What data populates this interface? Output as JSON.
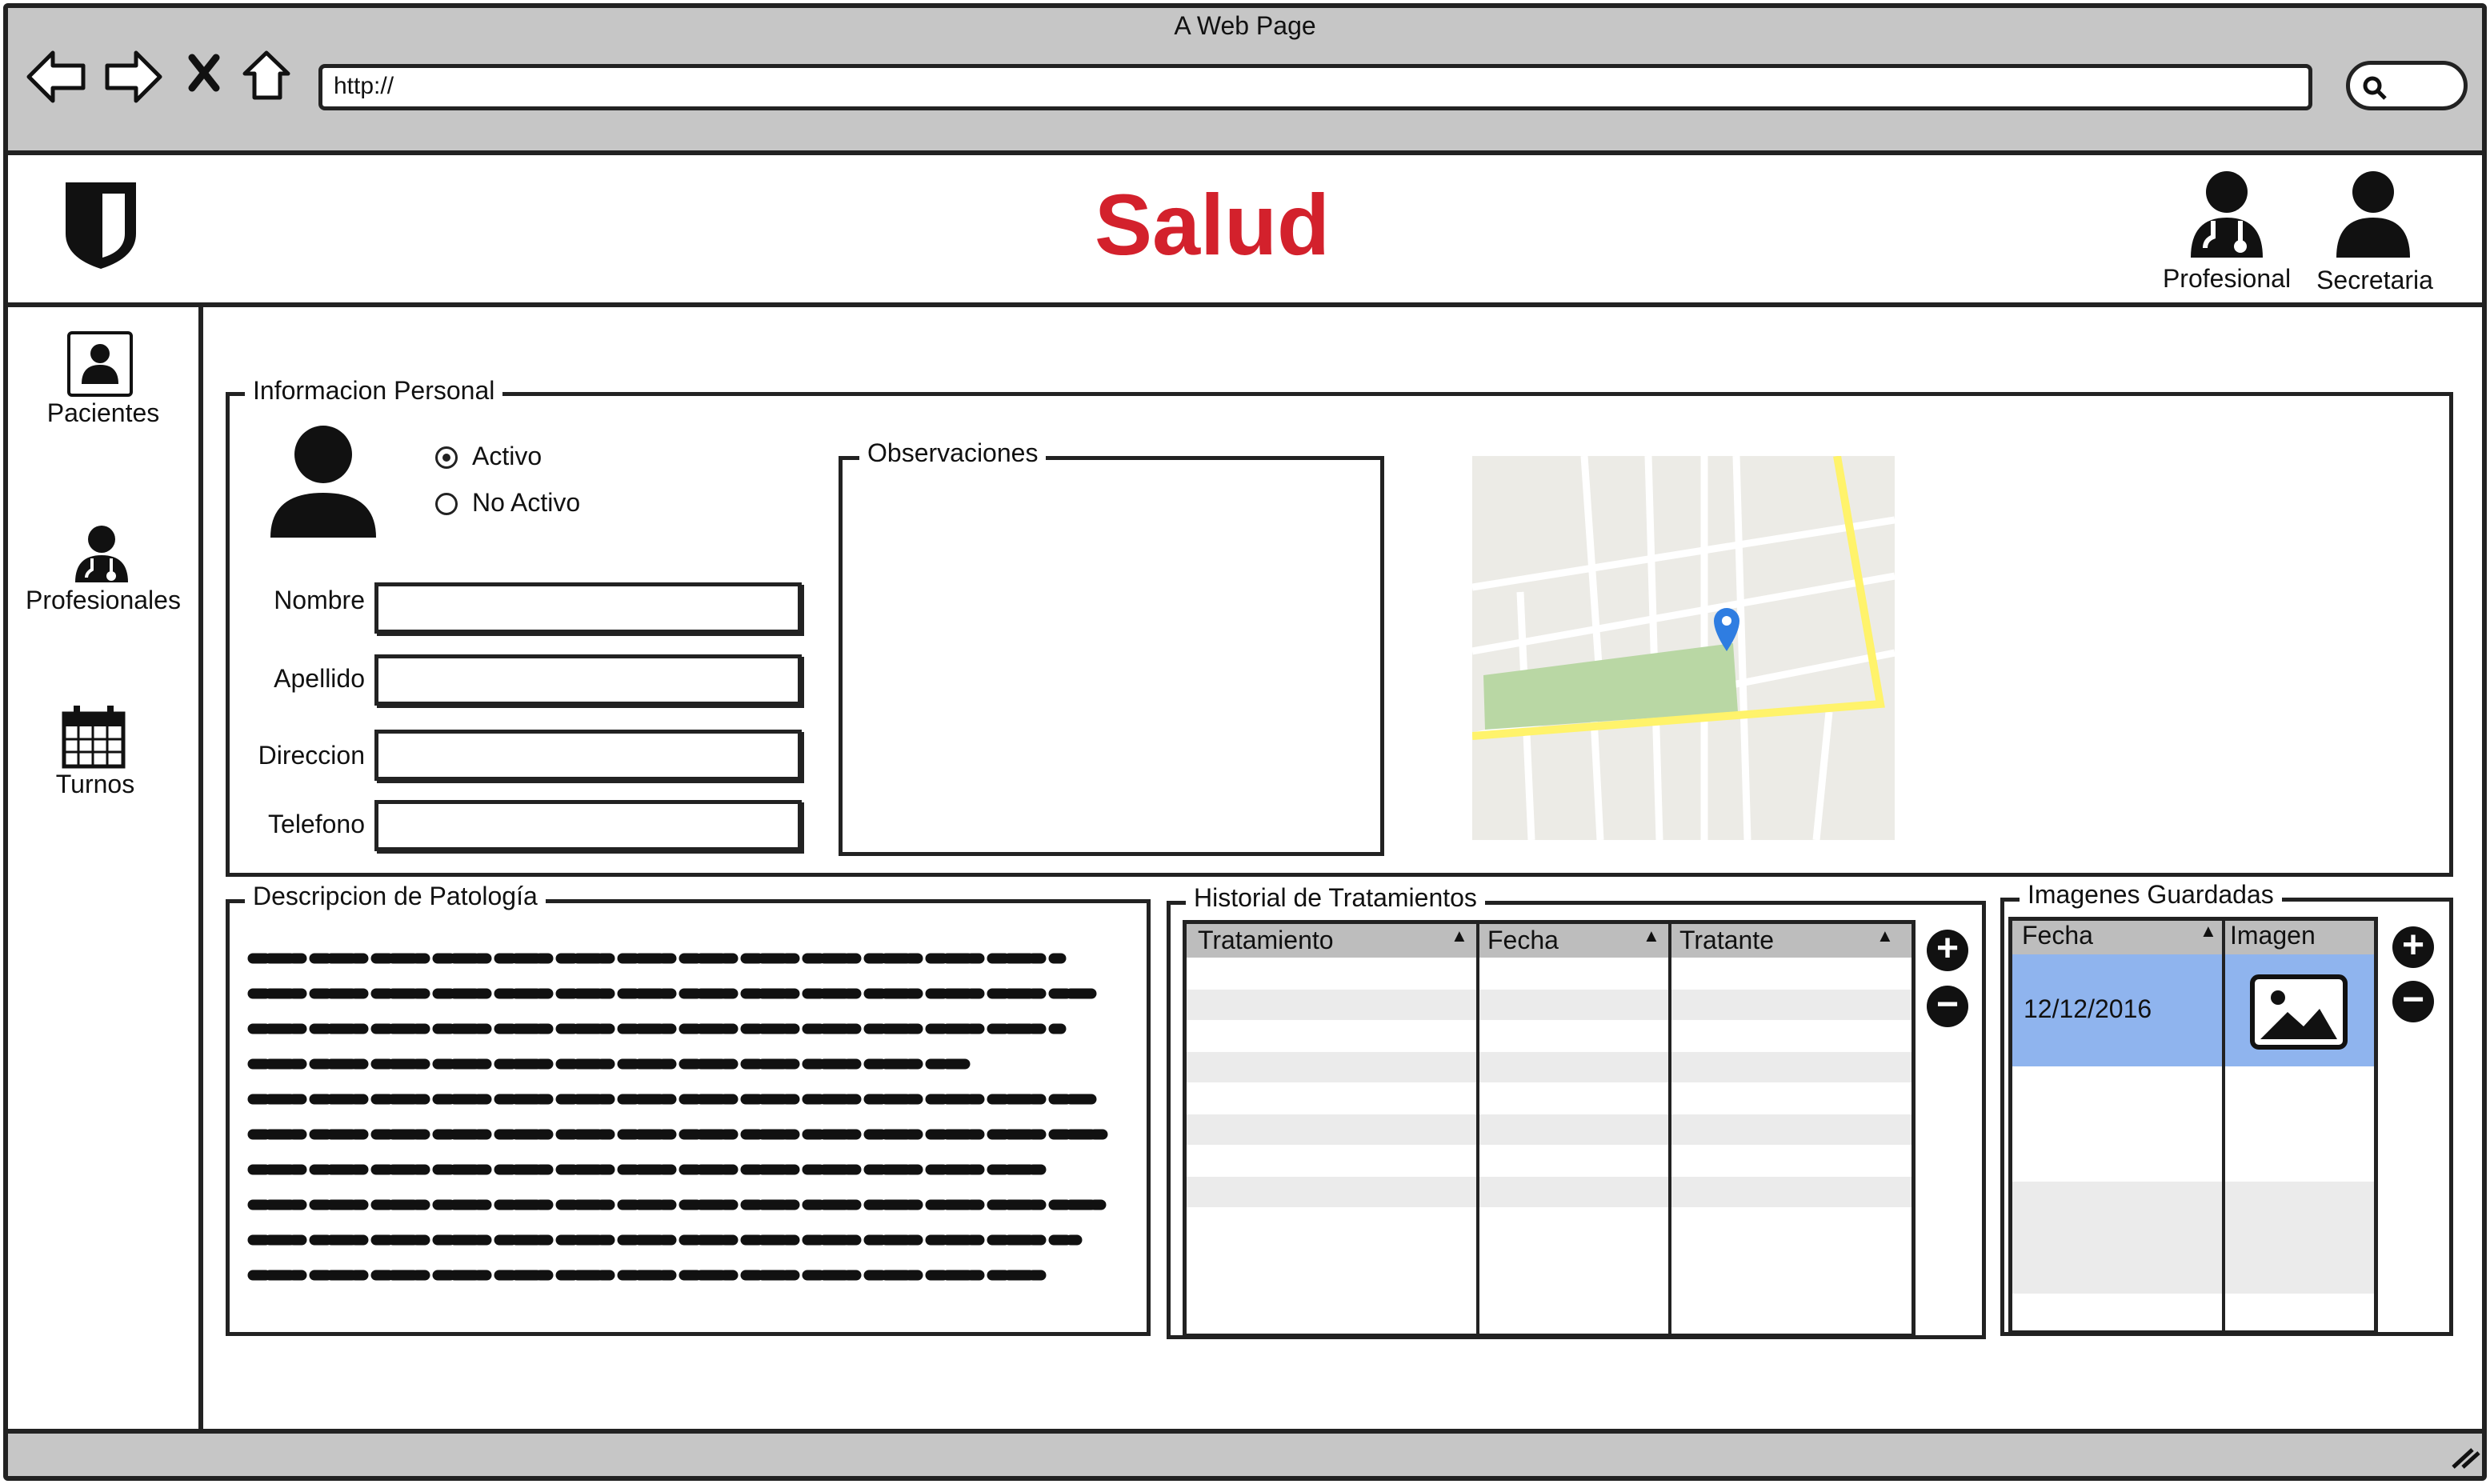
{
  "browser": {
    "window_title": "A Web Page",
    "url": "http://"
  },
  "header": {
    "app_title": "Salud",
    "users": [
      {
        "label": "Profesional",
        "icon": "doctor-icon"
      },
      {
        "label": "Secretaria",
        "icon": "user-icon"
      }
    ]
  },
  "sidebar": {
    "items": [
      {
        "label": "Pacientes",
        "icon": "patient-card-icon"
      },
      {
        "label": "Profesionales",
        "icon": "doctor-icon"
      },
      {
        "label": "Turnos",
        "icon": "calendar-icon"
      }
    ]
  },
  "personal_info": {
    "legend": "Informacion Personal",
    "status_options": [
      {
        "label": "Activo",
        "selected": true
      },
      {
        "label": "No Activo",
        "selected": false
      }
    ],
    "fields": [
      {
        "label": "Nombre",
        "value": ""
      },
      {
        "label": "Apellido",
        "value": ""
      },
      {
        "label": "Direccion",
        "value": ""
      },
      {
        "label": "Telefono",
        "value": ""
      }
    ],
    "observations_legend": "Observaciones",
    "observations_value": ""
  },
  "pathology": {
    "legend": "Descripcion de Patología"
  },
  "treatments": {
    "legend": "Historial de Tratamientos",
    "columns": [
      "Tratamiento",
      "Fecha",
      "Tratante"
    ],
    "rows": []
  },
  "images": {
    "legend": "Imagenes Guardadas",
    "columns": [
      "Fecha",
      "Imagen"
    ],
    "rows": [
      {
        "fecha": "12/12/2016",
        "imagen": "image-icon",
        "selected": true
      }
    ]
  },
  "colors": {
    "brand": "#d3212c",
    "chrome": "#c6c6c6",
    "selection": "#8fb4ee",
    "map_road": "#fff36b",
    "map_park": "#b9d7a4",
    "map_marker": "#2f7de1"
  }
}
